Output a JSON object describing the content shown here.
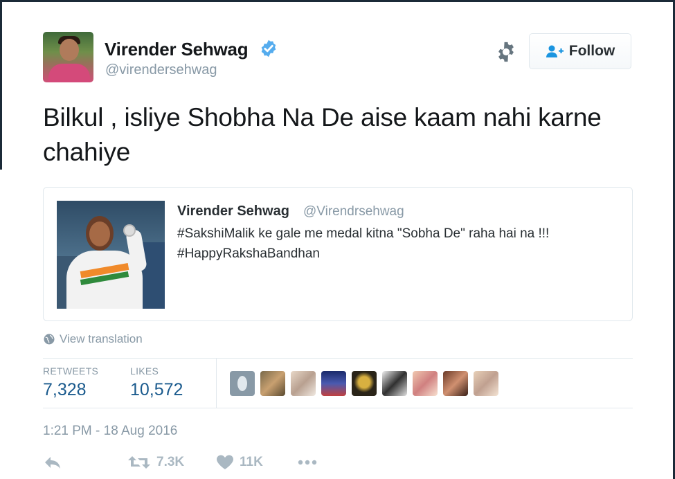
{
  "author": {
    "name": "Virender Sehwag",
    "handle": "@virendersehwag",
    "verified": true
  },
  "header": {
    "follow_label": "Follow"
  },
  "tweet": {
    "text": "Bilkul , isliye Shobha Na De aise kaam nahi karne chahiye"
  },
  "quoted": {
    "name": "Virender Sehwag",
    "handle": "@Virendrsehwag",
    "text_line1": "#SakshiMalik ke gale me medal kitna \"Sobha De\" raha hai na !!!",
    "text_line2": "#HappyRakshaBandhan"
  },
  "translate": {
    "label": "View translation"
  },
  "stats": {
    "retweets_label": "RETWEETS",
    "retweets_value": "7,328",
    "likes_label": "LIKES",
    "likes_value": "10,572"
  },
  "timestamp": "1:21 PM - 18 Aug 2016",
  "actions": {
    "retweet_count": "7.3K",
    "like_count": "11K"
  },
  "colors": {
    "link": "#1b5b8e",
    "muted": "#8899a6",
    "verified": "#55acee",
    "icon_muted": "#aab8c2"
  }
}
